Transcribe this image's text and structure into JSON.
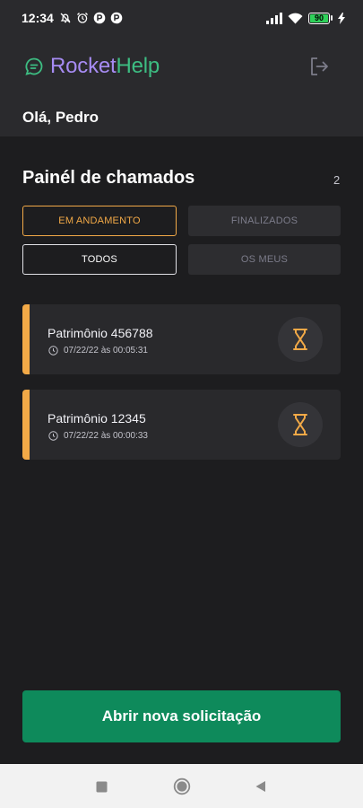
{
  "status_bar": {
    "time": "12:34",
    "battery": "90",
    "battery_color": "#2fd15a",
    "icons": [
      "mute-icon",
      "alarm-icon",
      "app-icon",
      "app-icon",
      "signal-icon",
      "wifi-icon",
      "battery-icon",
      "charging-icon"
    ]
  },
  "app": {
    "logo_part1": "Rocket",
    "logo_part2": "Help",
    "logo_colors": {
      "rocket": "#a68bf2",
      "help": "#3dbd82"
    },
    "logout_icon": "sign-out-icon"
  },
  "greeting": "Olá, Pedro",
  "panel": {
    "title": "Painél de chamados",
    "count": "2"
  },
  "filters": {
    "status": [
      {
        "label": "EM ANDAMENTO",
        "active": true
      },
      {
        "label": "FINALIZADOS",
        "active": false
      }
    ],
    "owner": [
      {
        "label": "TODOS",
        "active": true
      },
      {
        "label": "OS MEUS",
        "active": false
      }
    ]
  },
  "orders": [
    {
      "title": "Patrimônio 456788",
      "datetime": "07/22/22 às 00:05:31",
      "status_icon": "hourglass-icon",
      "status_color": "#f2a947"
    },
    {
      "title": "Patrimônio 12345",
      "datetime": "07/22/22 às 00:00:33",
      "status_icon": "hourglass-icon",
      "status_color": "#f2a947"
    }
  ],
  "new_request_button": "Abrir nova solicitação",
  "accent_colors": {
    "in_progress": "#f2a947",
    "primary": "#0e8a5b"
  },
  "nav_bar": [
    "recent-apps-icon",
    "home-icon",
    "back-icon"
  ]
}
